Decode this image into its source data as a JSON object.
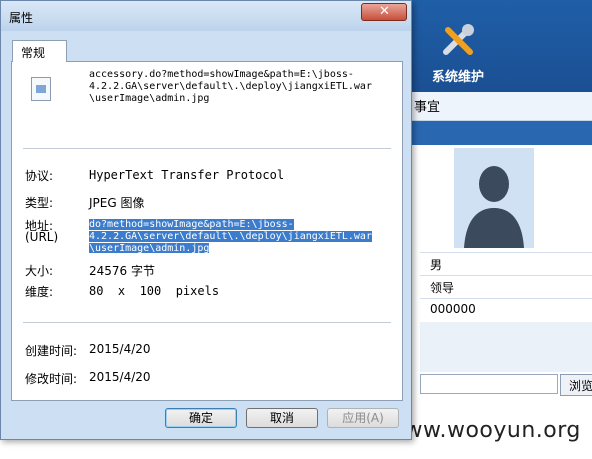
{
  "background_app": {
    "toolbar_label": "系统维护",
    "subnav_text": "事宜",
    "rows": [
      "男",
      "领导",
      "000000"
    ],
    "browse_label": "浏览"
  },
  "watermark": "www.wooyun.org",
  "dialog": {
    "title": "属性",
    "close_label": "✕",
    "tab_label": "常规",
    "file_name": "accessory.do?method=showImage&path=E:\\jboss-\n4.2.2.GA\\server\\default\\.\\deploy\\jiangxiETL.war\n\\userImage\\admin.jpg",
    "fields": {
      "protocol_label": "协议:",
      "protocol_value": "HyperText Transfer Protocol",
      "type_label": "类型:",
      "type_value": "JPEG 图像",
      "address_label": "地址:\n(URL)",
      "address_value": "do?method=showImage&path=E:\\jboss-\n4.2.2.GA\\server\\default\\.\\deploy\\jiangxiETL.war\n\\userImage\\admin.jpg",
      "size_label": "大小:",
      "size_value": "24576 字节",
      "dimension_label": "维度:",
      "dimension_value": "80  x  100  pixels",
      "created_label": "创建时间:",
      "created_value": "2015/4/20",
      "modified_label": "修改时间:",
      "modified_value": "2015/4/20"
    },
    "buttons": {
      "ok": "确定",
      "cancel": "取消",
      "apply": "应用(A)"
    }
  }
}
